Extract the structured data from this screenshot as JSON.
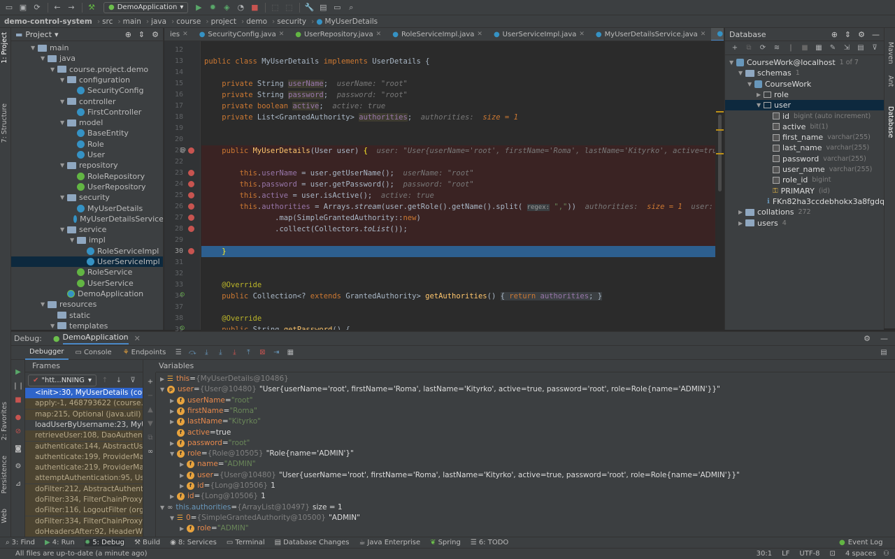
{
  "toolbar": {
    "run_config": "DemoApplication"
  },
  "nav": {
    "crumbs": [
      "demo-control-system",
      "src",
      "main",
      "java",
      "course",
      "project",
      "demo",
      "security",
      "MyUserDetails"
    ]
  },
  "left_strip": {
    "project": "1: Project",
    "structure": "7: Structure",
    "favorites": "2: Favorites",
    "persistence": "Persistence",
    "web": "Web"
  },
  "right_strip": {
    "maven": "Maven",
    "ant": "Ant",
    "database": "Database"
  },
  "project": {
    "title": "Project",
    "tree": [
      {
        "label": "main",
        "depth": 2,
        "icon": "folder",
        "arrow": "down"
      },
      {
        "label": "java",
        "depth": 3,
        "icon": "folder",
        "arrow": "down"
      },
      {
        "label": "course.project.demo",
        "depth": 4,
        "icon": "folder",
        "arrow": "down"
      },
      {
        "label": "configuration",
        "depth": 5,
        "icon": "folder",
        "arrow": "down"
      },
      {
        "label": "SecurityConfig",
        "depth": 6,
        "icon": "class"
      },
      {
        "label": "controller",
        "depth": 5,
        "icon": "folder",
        "arrow": "down"
      },
      {
        "label": "FirstController",
        "depth": 6,
        "icon": "class"
      },
      {
        "label": "model",
        "depth": 5,
        "icon": "folder",
        "arrow": "down"
      },
      {
        "label": "BaseEntity",
        "depth": 6,
        "icon": "class"
      },
      {
        "label": "Role",
        "depth": 6,
        "icon": "class"
      },
      {
        "label": "User",
        "depth": 6,
        "icon": "class"
      },
      {
        "label": "repository",
        "depth": 5,
        "icon": "folder",
        "arrow": "down"
      },
      {
        "label": "RoleRepository",
        "depth": 6,
        "icon": "interface"
      },
      {
        "label": "UserRepository",
        "depth": 6,
        "icon": "interface"
      },
      {
        "label": "security",
        "depth": 5,
        "icon": "folder",
        "arrow": "down"
      },
      {
        "label": "MyUserDetails",
        "depth": 6,
        "icon": "class"
      },
      {
        "label": "MyUserDetailsService",
        "depth": 6,
        "icon": "class"
      },
      {
        "label": "service",
        "depth": 5,
        "icon": "folder",
        "arrow": "down"
      },
      {
        "label": "impl",
        "depth": 6,
        "icon": "folder",
        "arrow": "down"
      },
      {
        "label": "RoleServiceImpl",
        "depth": 7,
        "icon": "class"
      },
      {
        "label": "UserServiceImpl",
        "depth": 7,
        "icon": "class",
        "selected": true
      },
      {
        "label": "RoleService",
        "depth": 6,
        "icon": "interface"
      },
      {
        "label": "UserService",
        "depth": 6,
        "icon": "interface"
      },
      {
        "label": "DemoApplication",
        "depth": 5,
        "icon": "spring"
      },
      {
        "label": "resources",
        "depth": 3,
        "icon": "folder",
        "arrow": "down"
      },
      {
        "label": "static",
        "depth": 4,
        "icon": "folder"
      },
      {
        "label": "templates",
        "depth": 4,
        "icon": "folder",
        "arrow": "down"
      }
    ]
  },
  "editor": {
    "tabs": [
      {
        "label": "ies",
        "active": false
      },
      {
        "label": "SecurityConfig.java",
        "active": false
      },
      {
        "label": "UserRepository.java",
        "active": false
      },
      {
        "label": "RoleServiceImpl.java",
        "active": false
      },
      {
        "label": "UserServiceImpl.java",
        "active": false
      },
      {
        "label": "MyUserDetailsService.java",
        "active": false
      },
      {
        "label": "MyUserDetails.java",
        "active": true
      }
    ],
    "line_numbers": [
      "12",
      "13",
      "14",
      "15",
      "16",
      "17",
      "18",
      "19",
      "20",
      "21",
      "22",
      "23",
      "24",
      "25",
      "26",
      "27",
      "28",
      "29",
      "30",
      "31",
      "32",
      "33",
      "34",
      "37",
      "38",
      "39"
    ]
  },
  "database": {
    "title": "Database",
    "tree": [
      {
        "label": "CourseWork@localhost",
        "extra": "1 of 7",
        "depth": 0,
        "icon": "db",
        "arrow": "down"
      },
      {
        "label": "schemas",
        "extra": "1",
        "depth": 1,
        "icon": "folder",
        "arrow": "down"
      },
      {
        "label": "CourseWork",
        "extra": "",
        "depth": 2,
        "icon": "db",
        "arrow": "down"
      },
      {
        "label": "role",
        "extra": "",
        "depth": 3,
        "icon": "table",
        "arrow": "right"
      },
      {
        "label": "user",
        "extra": "",
        "depth": 3,
        "icon": "table",
        "arrow": "down",
        "selected": true
      },
      {
        "label": "id",
        "extra": "bigint (auto increment)",
        "depth": 4,
        "icon": "col"
      },
      {
        "label": "active",
        "extra": "bit(1)",
        "depth": 4,
        "icon": "col"
      },
      {
        "label": "first_name",
        "extra": "varchar(255)",
        "depth": 4,
        "icon": "col"
      },
      {
        "label": "last_name",
        "extra": "varchar(255)",
        "depth": 4,
        "icon": "col"
      },
      {
        "label": "password",
        "extra": "varchar(255)",
        "depth": 4,
        "icon": "col"
      },
      {
        "label": "user_name",
        "extra": "varchar(255)",
        "depth": 4,
        "icon": "col"
      },
      {
        "label": "role_id",
        "extra": "bigint",
        "depth": 4,
        "icon": "col"
      },
      {
        "label": "PRIMARY",
        "extra": "(id)",
        "depth": 4,
        "icon": "key"
      },
      {
        "label": "FKn82ha3ccdebhokx3a8fgdq",
        "extra": "",
        "depth": 4,
        "icon": "fk"
      },
      {
        "label": "collations",
        "extra": "272",
        "depth": 1,
        "icon": "folder",
        "arrow": "right"
      },
      {
        "label": "users",
        "extra": "4",
        "depth": 1,
        "icon": "folder",
        "arrow": "right"
      }
    ]
  },
  "debug": {
    "title": "Debug:",
    "config": "DemoApplication",
    "tabs": [
      "Debugger",
      "Console",
      "Endpoints"
    ],
    "frames_title": "Frames",
    "thread": "\"htt...NNING",
    "frames": [
      {
        "text": "<init>:30, MyUserDetails (cours",
        "type": "sel"
      },
      {
        "text": "apply:-1, 468793622 (course.pr",
        "type": "lib"
      },
      {
        "text": "map:215, Optional (java.util)",
        "type": "lib"
      },
      {
        "text": "loadUserByUsername:23, MyUs",
        "type": "norm"
      },
      {
        "text": "retrieveUser:108, DaoAuthentic",
        "type": "lib"
      },
      {
        "text": "authenticate:144, AbstractUser",
        "type": "lib"
      },
      {
        "text": "authenticate:199, ProviderMana",
        "type": "lib"
      },
      {
        "text": "authenticate:219, ProviderMana",
        "type": "lib"
      },
      {
        "text": "attemptAuthentication:95, User",
        "type": "lib"
      },
      {
        "text": "doFilter:212, AbstractAuthentica",
        "type": "lib"
      },
      {
        "text": "doFilter:334, FilterChainProxy$V",
        "type": "lib"
      },
      {
        "text": "doFilter:116, LogoutFilter (org.sp",
        "type": "lib"
      },
      {
        "text": "doFilter:334, FilterChainProxy$V",
        "type": "lib"
      },
      {
        "text": "doHeadersAfter:92, HeaderWri",
        "type": "lib"
      }
    ],
    "variables_title": "Variables",
    "variables": [
      {
        "depth": 0,
        "arrow": "right",
        "icon": "stack",
        "name": "this",
        "type": "{MyUserDetails@10486}",
        "value": ""
      },
      {
        "depth": 0,
        "arrow": "down",
        "icon": "p",
        "name": "user",
        "type": "{User@10480}",
        "value": "\"User{userName='root', firstName='Roma', lastName='Kityrko', active=true, password='root', role=Role{name='ADMIN'}}\""
      },
      {
        "depth": 1,
        "arrow": "right",
        "icon": "f",
        "name": "userName",
        "type": "",
        "value": "\"root\"",
        "str": true
      },
      {
        "depth": 1,
        "arrow": "right",
        "icon": "f",
        "name": "firstName",
        "type": "",
        "value": "\"Roma\"",
        "str": true
      },
      {
        "depth": 1,
        "arrow": "right",
        "icon": "f",
        "name": "lastName",
        "type": "",
        "value": "\"Kityrko\"",
        "str": true
      },
      {
        "depth": 1,
        "arrow": "",
        "icon": "f",
        "name": "active",
        "type": "",
        "value": "true"
      },
      {
        "depth": 1,
        "arrow": "right",
        "icon": "f",
        "name": "password",
        "type": "",
        "value": "\"root\"",
        "str": true
      },
      {
        "depth": 1,
        "arrow": "down",
        "icon": "f",
        "name": "role",
        "type": "{Role@10505}",
        "value": "\"Role{name='ADMIN'}\""
      },
      {
        "depth": 2,
        "arrow": "right",
        "icon": "f",
        "name": "name",
        "type": "",
        "value": "\"ADMIN\"",
        "str": true
      },
      {
        "depth": 2,
        "arrow": "right",
        "icon": "f",
        "name": "user",
        "type": "{User@10480}",
        "value": "\"User{userName='root', firstName='Roma', lastName='Kityrko', active=true, password='root', role=Role{name='ADMIN'}}\""
      },
      {
        "depth": 2,
        "arrow": "right",
        "icon": "f",
        "name": "id",
        "type": "{Long@10506}",
        "value": "1"
      },
      {
        "depth": 1,
        "arrow": "right",
        "icon": "f",
        "name": "id",
        "type": "{Long@10506}",
        "value": "1"
      },
      {
        "depth": 0,
        "arrow": "down",
        "icon": "oo",
        "name": "this.authorities",
        "type": "{ArrayList@10497}",
        "value": " size = 1"
      },
      {
        "depth": 1,
        "arrow": "down",
        "icon": "stack",
        "name": "0",
        "type": "{SimpleGrantedAuthority@10500}",
        "value": "\"ADMIN\""
      },
      {
        "depth": 2,
        "arrow": "right",
        "icon": "f",
        "name": "role",
        "type": "",
        "value": "\"ADMIN\"",
        "str": true
      }
    ]
  },
  "bottom_tools": [
    "3: Find",
    "4: Run",
    "5: Debug",
    "Build",
    "8: Services",
    "Terminal",
    "Database Changes",
    "Java Enterprise",
    "Spring",
    "6: TODO"
  ],
  "event_log": "Event Log",
  "status": {
    "message": "All files are up-to-date (a minute ago)",
    "position": "30:1",
    "line_sep": "LF",
    "encoding": "UTF-8",
    "indent": "4 spaces"
  }
}
